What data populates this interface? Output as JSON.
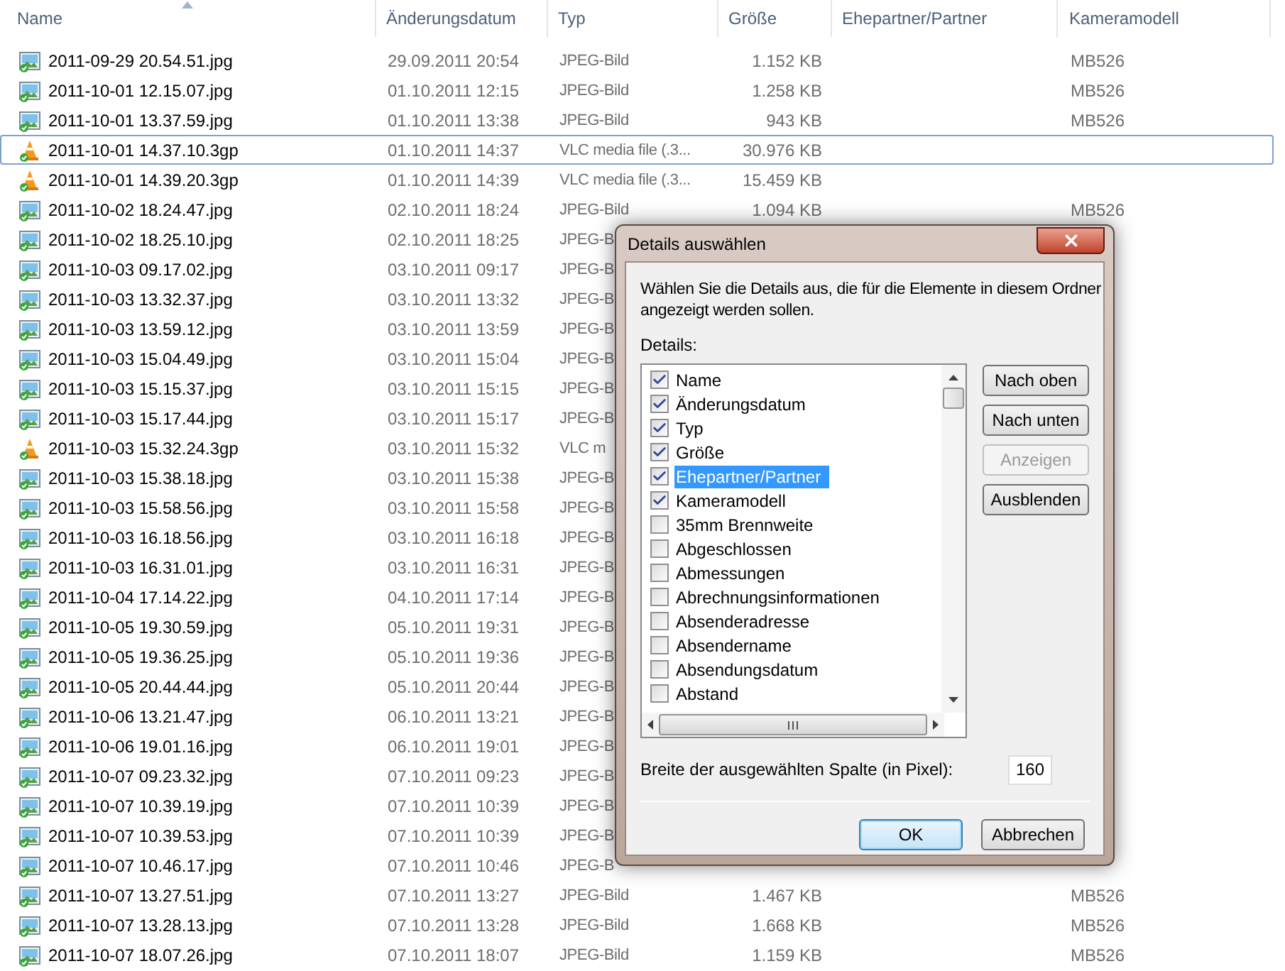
{
  "columns": [
    {
      "label": "Name",
      "sorted": true
    },
    {
      "label": "Änderungsdatum",
      "sorted": false
    },
    {
      "label": "Typ",
      "sorted": false
    },
    {
      "label": "Größe",
      "sorted": false
    },
    {
      "label": "Ehepartner/Partner",
      "sorted": false
    },
    {
      "label": "Kameramodell",
      "sorted": false
    }
  ],
  "rows": [
    {
      "kind": "jpg",
      "name": "2011-09-29 20.54.51.jpg",
      "date": "29.09.2011 20:54",
      "type": "JPEG-Bild",
      "size": "1.152 KB",
      "camera": "MB526",
      "focused": false
    },
    {
      "kind": "jpg",
      "name": "2011-10-01 12.15.07.jpg",
      "date": "01.10.2011 12:15",
      "type": "JPEG-Bild",
      "size": "1.258 KB",
      "camera": "MB526",
      "focused": false
    },
    {
      "kind": "jpg",
      "name": "2011-10-01 13.37.59.jpg",
      "date": "01.10.2011 13:38",
      "type": "JPEG-Bild",
      "size": "943 KB",
      "camera": "MB526",
      "focused": false
    },
    {
      "kind": "vlc",
      "name": "2011-10-01 14.37.10.3gp",
      "date": "01.10.2011 14:37",
      "type": "VLC media file (.3...",
      "size": "30.976 KB",
      "focused": true
    },
    {
      "kind": "vlc",
      "name": "2011-10-01 14.39.20.3gp",
      "date": "01.10.2011 14:39",
      "type": "VLC media file (.3...",
      "size": "15.459 KB",
      "focused": false
    },
    {
      "kind": "jpg",
      "name": "2011-10-02 18.24.47.jpg",
      "date": "02.10.2011 18:24",
      "type": "JPEG-Bild",
      "size": "1.094 KB",
      "camera": "MB526",
      "focused": false
    },
    {
      "kind": "jpg",
      "name": "2011-10-02 18.25.10.jpg",
      "date": "02.10.2011 18:25",
      "type": "JPEG-B",
      "focused": false
    },
    {
      "kind": "jpg",
      "name": "2011-10-03 09.17.02.jpg",
      "date": "03.10.2011 09:17",
      "type": "JPEG-B",
      "focused": false
    },
    {
      "kind": "jpg",
      "name": "2011-10-03 13.32.37.jpg",
      "date": "03.10.2011 13:32",
      "type": "JPEG-B",
      "focused": false
    },
    {
      "kind": "jpg",
      "name": "2011-10-03 13.59.12.jpg",
      "date": "03.10.2011 13:59",
      "type": "JPEG-B",
      "focused": false
    },
    {
      "kind": "jpg",
      "name": "2011-10-03 15.04.49.jpg",
      "date": "03.10.2011 15:04",
      "type": "JPEG-B",
      "focused": false
    },
    {
      "kind": "jpg",
      "name": "2011-10-03 15.15.37.jpg",
      "date": "03.10.2011 15:15",
      "type": "JPEG-B",
      "focused": false
    },
    {
      "kind": "jpg",
      "name": "2011-10-03 15.17.44.jpg",
      "date": "03.10.2011 15:17",
      "type": "JPEG-B",
      "focused": false
    },
    {
      "kind": "vlc",
      "name": "2011-10-03 15.32.24.3gp",
      "date": "03.10.2011 15:32",
      "type": "VLC m",
      "focused": false
    },
    {
      "kind": "jpg",
      "name": "2011-10-03 15.38.18.jpg",
      "date": "03.10.2011 15:38",
      "type": "JPEG-B",
      "focused": false
    },
    {
      "kind": "jpg",
      "name": "2011-10-03 15.58.56.jpg",
      "date": "03.10.2011 15:58",
      "type": "JPEG-B",
      "focused": false
    },
    {
      "kind": "jpg",
      "name": "2011-10-03 16.18.56.jpg",
      "date": "03.10.2011 16:18",
      "type": "JPEG-B",
      "focused": false
    },
    {
      "kind": "jpg",
      "name": "2011-10-03 16.31.01.jpg",
      "date": "03.10.2011 16:31",
      "type": "JPEG-B",
      "focused": false
    },
    {
      "kind": "jpg",
      "name": "2011-10-04 17.14.22.jpg",
      "date": "04.10.2011 17:14",
      "type": "JPEG-B",
      "focused": false
    },
    {
      "kind": "jpg",
      "name": "2011-10-05 19.30.59.jpg",
      "date": "05.10.2011 19:31",
      "type": "JPEG-B",
      "focused": false
    },
    {
      "kind": "jpg",
      "name": "2011-10-05 19.36.25.jpg",
      "date": "05.10.2011 19:36",
      "type": "JPEG-B",
      "focused": false
    },
    {
      "kind": "jpg",
      "name": "2011-10-05 20.44.44.jpg",
      "date": "05.10.2011 20:44",
      "type": "JPEG-B",
      "focused": false
    },
    {
      "kind": "jpg",
      "name": "2011-10-06 13.21.47.jpg",
      "date": "06.10.2011 13:21",
      "type": "JPEG-B",
      "focused": false
    },
    {
      "kind": "jpg",
      "name": "2011-10-06 19.01.16.jpg",
      "date": "06.10.2011 19:01",
      "type": "JPEG-B",
      "focused": false
    },
    {
      "kind": "jpg",
      "name": "2011-10-07 09.23.32.jpg",
      "date": "07.10.2011 09:23",
      "type": "JPEG-B",
      "focused": false
    },
    {
      "kind": "jpg",
      "name": "2011-10-07 10.39.19.jpg",
      "date": "07.10.2011 10:39",
      "type": "JPEG-B",
      "focused": false
    },
    {
      "kind": "jpg",
      "name": "2011-10-07 10.39.53.jpg",
      "date": "07.10.2011 10:39",
      "type": "JPEG-B",
      "focused": false
    },
    {
      "kind": "jpg",
      "name": "2011-10-07 10.46.17.jpg",
      "date": "07.10.2011 10:46",
      "type": "JPEG-B",
      "focused": false
    },
    {
      "kind": "jpg",
      "name": "2011-10-07 13.27.51.jpg",
      "date": "07.10.2011 13:27",
      "type": "JPEG-Bild",
      "size": "1.467 KB",
      "camera": "MB526",
      "focused": false
    },
    {
      "kind": "jpg",
      "name": "2011-10-07 13.28.13.jpg",
      "date": "07.10.2011 13:28",
      "type": "JPEG-Bild",
      "size": "1.668 KB",
      "camera": "MB526",
      "focused": false
    },
    {
      "kind": "jpg",
      "name": "2011-10-07 18.07.26.jpg",
      "date": "07.10.2011 18:07",
      "type": "JPEG-Bild",
      "size": "1.159 KB",
      "camera": "MB526",
      "focused": false
    }
  ],
  "dialog": {
    "title": "Details auswählen",
    "description": "Wählen Sie die Details aus, die für die Elemente in diesem Ordner angezeigt werden sollen.",
    "details_label": "Details:",
    "details": [
      {
        "label": "Name",
        "checked": true,
        "selected": false
      },
      {
        "label": "Änderungsdatum",
        "checked": true,
        "selected": false
      },
      {
        "label": "Typ",
        "checked": true,
        "selected": false
      },
      {
        "label": "Größe",
        "checked": true,
        "selected": false
      },
      {
        "label": "Ehepartner/Partner",
        "checked": true,
        "selected": true
      },
      {
        "label": "Kameramodell",
        "checked": true,
        "selected": false
      },
      {
        "label": "35mm Brennweite",
        "checked": false,
        "selected": false
      },
      {
        "label": "Abgeschlossen",
        "checked": false,
        "selected": false
      },
      {
        "label": "Abmessungen",
        "checked": false,
        "selected": false
      },
      {
        "label": "Abrechnungsinformationen",
        "checked": false,
        "selected": false
      },
      {
        "label": "Absenderadresse",
        "checked": false,
        "selected": false
      },
      {
        "label": "Absendername",
        "checked": false,
        "selected": false
      },
      {
        "label": "Absendungsdatum",
        "checked": false,
        "selected": false
      },
      {
        "label": "Abstand",
        "checked": false,
        "selected": false
      }
    ],
    "side_buttons": [
      {
        "label": "Nach oben",
        "disabled": false
      },
      {
        "label": "Nach unten",
        "disabled": false
      },
      {
        "label": "Anzeigen",
        "disabled": true
      },
      {
        "label": "Ausblenden",
        "disabled": false
      }
    ],
    "width_label": "Breite der ausgewählten Spalte (in Pixel):",
    "width_value": "160",
    "footer_buttons": [
      {
        "label": "OK",
        "default": true
      },
      {
        "label": "Abbrechen",
        "default": false
      }
    ]
  }
}
